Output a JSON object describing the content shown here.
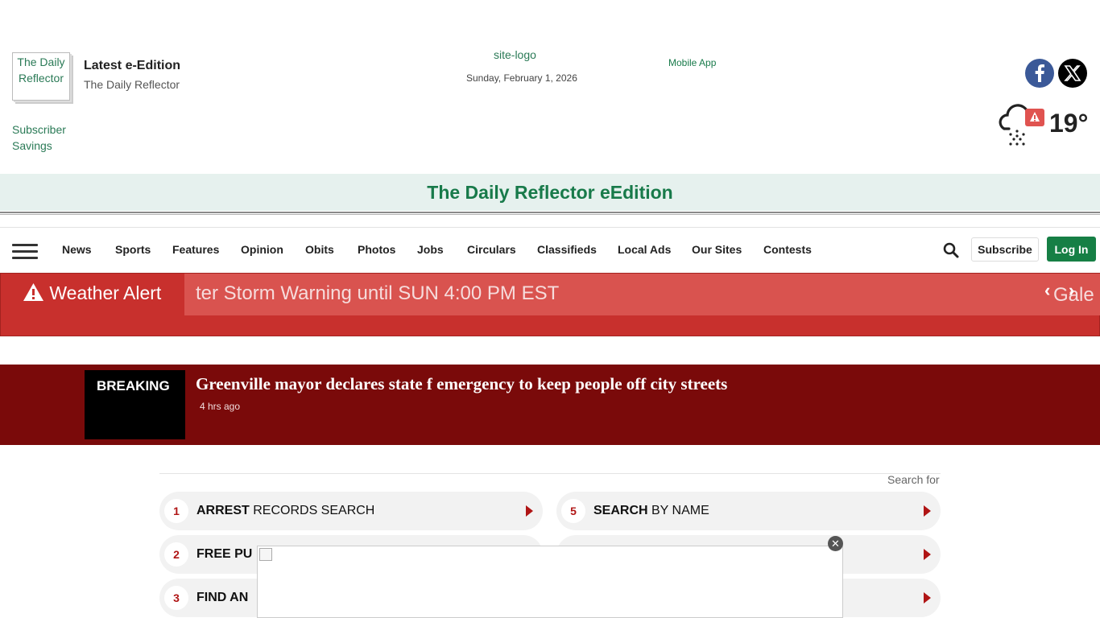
{
  "header": {
    "edition_thumb_alt": "The Daily Reflector",
    "edition_title": "Latest e-Edition",
    "edition_subtitle": "The Daily Reflector",
    "subscriber_alt": "Subscriber Savings",
    "site_logo_alt": "site-logo",
    "date": "Sunday, February 1, 2026",
    "mobile_app": "Mobile App",
    "temperature": "19°"
  },
  "banner": {
    "title": "The Daily Reflector eEdition"
  },
  "nav": {
    "items": [
      "News",
      "Sports",
      "Features",
      "Opinion",
      "Obits",
      "Photos",
      "Jobs",
      "Circulars",
      "Classifieds",
      "Local Ads",
      "Our Sites",
      "Contests"
    ],
    "subscribe": "Subscribe",
    "login": "Log In"
  },
  "alert": {
    "title": "Weather Alert",
    "ticker": "ter Storm Warning until SUN 4:00 PM EST",
    "ticker_next": "Gale",
    "prev": "‹",
    "next": "›"
  },
  "breaking": {
    "tag": "BREAKING",
    "headline": "Greenville mayor declares state f emergency to keep people off city streets",
    "time": "4 hrs ago"
  },
  "search": {
    "label": "Search for",
    "items": [
      {
        "num": "1",
        "bold": "ARREST",
        "rest": " RECORDS SEARCH"
      },
      {
        "num": "5",
        "bold": "SEARCH",
        "rest": " BY NAME"
      },
      {
        "num": "2",
        "bold": "",
        "rest": "FREE PU"
      },
      {
        "num": "",
        "bold": "",
        "rest": ""
      },
      {
        "num": "3",
        "bold": "",
        "rest": "FIND AN"
      },
      {
        "num": "",
        "bold": "",
        "rest": ""
      }
    ]
  },
  "ad": {
    "close": "✕"
  },
  "colors": {
    "brand_green": "#187a4a",
    "alert_red": "#c8302d",
    "breaking_red": "#7a0a0a"
  }
}
